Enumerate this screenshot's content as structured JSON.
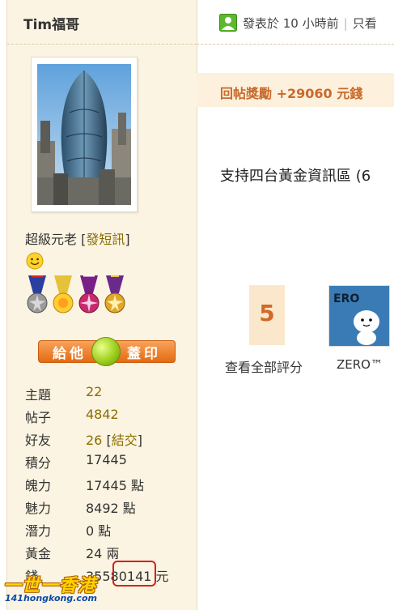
{
  "author": {
    "name": "Tim福哥",
    "rank": "超級元老",
    "pm_link": "發短訊"
  },
  "stamp": {
    "left_label": "給他",
    "right_label": "蓋印"
  },
  "stats": [
    {
      "label": "主題",
      "value": "22",
      "style": "gold"
    },
    {
      "label": "帖子",
      "value": "4842",
      "style": "gold"
    },
    {
      "label": "好友",
      "value": "26",
      "extra": "結交",
      "style": "friend"
    },
    {
      "label": "積分",
      "value": "17445",
      "style": "plain"
    },
    {
      "label": "魄力",
      "value": "17445 點",
      "style": "plain"
    },
    {
      "label": "魅力",
      "value": "8492 點",
      "style": "plain"
    },
    {
      "label": "潛力",
      "value": "0 點",
      "style": "plain"
    },
    {
      "label": "黃金",
      "value": "24 兩",
      "style": "plain"
    },
    {
      "label": "錢",
      "value": "35580141 元",
      "style": "plain"
    }
  ],
  "watermark": {
    "main": "一世一香港",
    "sub": "141hongkong.com"
  },
  "post": {
    "posted": "發表於 10 小時前",
    "only_view": "只看",
    "reward": "回帖獎勵 +29060 元錢",
    "body": "支持四台黃金資訊區 (6"
  },
  "rating": {
    "score": "5",
    "view_all": "查看全部評分",
    "rater_name": "ZERO™"
  },
  "colors": {
    "sidebar_bg": "#fbf4e2",
    "link_gold": "#8a6d00",
    "reward_orange": "#c86a2c",
    "highlight_red": "#d62020"
  }
}
